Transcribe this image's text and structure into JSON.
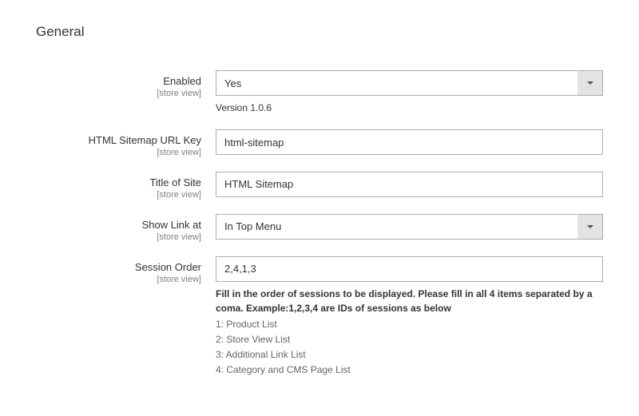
{
  "section": {
    "title": "General"
  },
  "fields": {
    "enabled": {
      "label": "Enabled",
      "scope": "[store view]",
      "value": "Yes",
      "version": "Version 1.0.6"
    },
    "urlkey": {
      "label": "HTML Sitemap URL Key",
      "scope": "[store view]",
      "value": "html-sitemap"
    },
    "titleofsite": {
      "label": "Title of Site",
      "scope": "[store view]",
      "value": "HTML Sitemap"
    },
    "showlink": {
      "label": "Show Link at",
      "scope": "[store view]",
      "value": "In Top Menu"
    },
    "sessionorder": {
      "label": "Session Order",
      "scope": "[store view]",
      "value": "2,4,1,3",
      "help_bold": "Fill in the order of sessions to be displayed. Please fill in all 4 items separated by a coma. Example:1,2,3,4 are IDs of sessions as below",
      "help_1": "1: Product List",
      "help_2": "2: Store View List",
      "help_3": "3: Additional Link List",
      "help_4": "4: Category and CMS Page List"
    }
  }
}
